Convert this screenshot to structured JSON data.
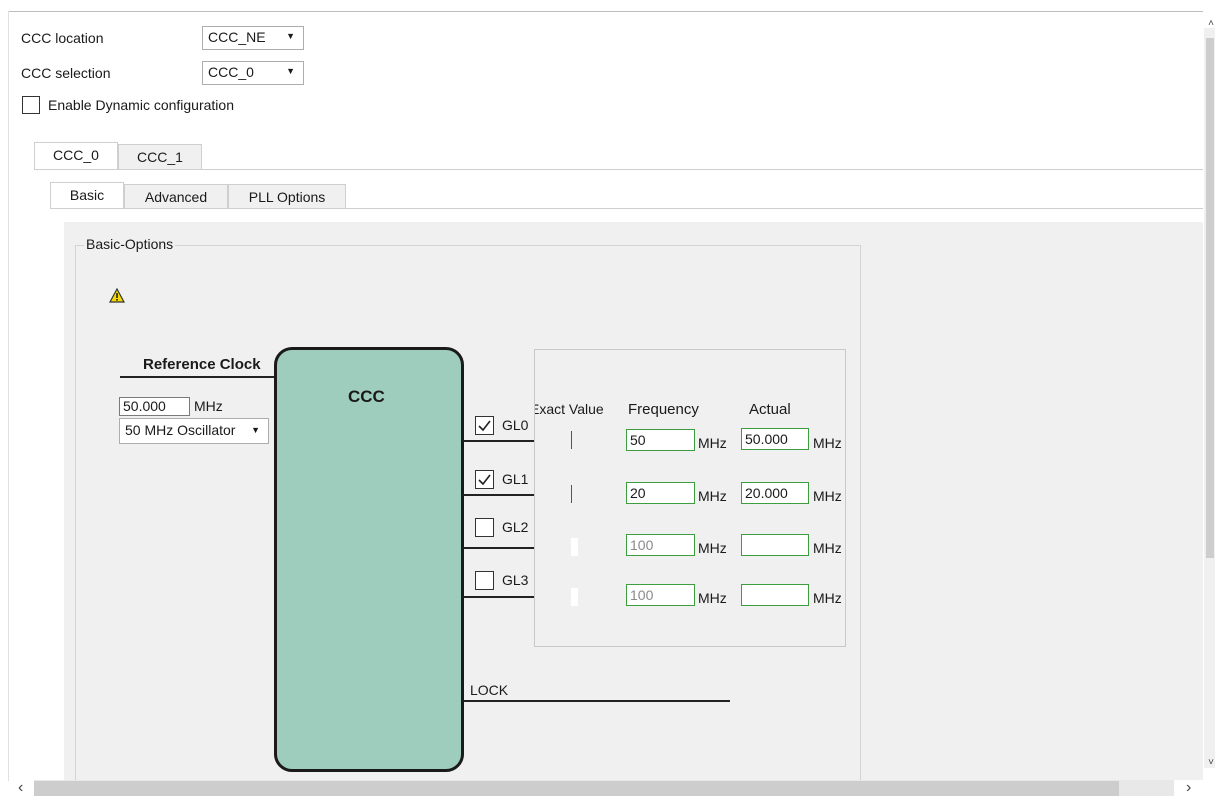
{
  "top": {
    "ccc_location_label": "CCC location",
    "ccc_location_value": "CCC_NE",
    "ccc_selection_label": "CCC selection",
    "ccc_selection_value": "CCC_0",
    "dynamic_label": "Enable Dynamic configuration"
  },
  "ccc_tabs": [
    "CCC_0",
    "CCC_1"
  ],
  "sub_tabs": [
    "Basic",
    "Advanced",
    "PLL Options"
  ],
  "basic": {
    "group_title": "Basic-Options",
    "warning_icon": "warning-icon",
    "ref_clock_label": "Reference Clock",
    "ref_freq_value": "50.000",
    "ref_freq_unit": "MHz",
    "ref_source": "50 MHz Oscillator",
    "ccc_block_label": "CCC",
    "lock_label": "LOCK"
  },
  "outputs": {
    "headers": {
      "exact": "Exact Value",
      "frequency": "Frequency",
      "actual": "Actual"
    },
    "unit": "MHz",
    "rows": [
      {
        "name": "GL0",
        "checked": true,
        "freq": "50",
        "actual": "50.000"
      },
      {
        "name": "GL1",
        "checked": true,
        "freq": "20",
        "actual": "20.000"
      },
      {
        "name": "GL2",
        "checked": false,
        "freq": "100",
        "actual": ""
      },
      {
        "name": "GL3",
        "checked": false,
        "freq": "100",
        "actual": ""
      }
    ]
  },
  "colors": {
    "ccc_block": "#9ecdbd",
    "field_border": "#3e9e3e",
    "warning": "#f5d800"
  }
}
